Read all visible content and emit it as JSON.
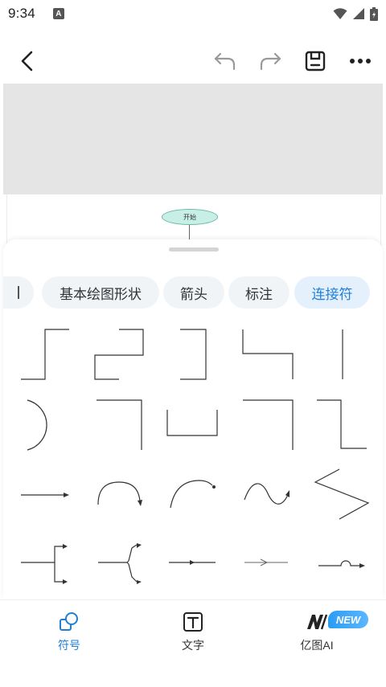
{
  "status_bar": {
    "time": "9:34",
    "notification_letter": "A"
  },
  "canvas": {
    "start_node_label": "开始"
  },
  "categories": [
    {
      "label": "",
      "active": false
    },
    {
      "label": "基本绘图形状",
      "active": false
    },
    {
      "label": "箭头",
      "active": false
    },
    {
      "label": "标注",
      "active": false
    },
    {
      "label": "连接符",
      "active": true
    }
  ],
  "connector_shapes": [
    "step-connector",
    "double-step-connector",
    "bracket-connector",
    "reverse-step-connector",
    "vertical-line",
    "arc-connector",
    "corner-connector",
    "u-connector",
    "corner-down-connector",
    "step-down-connector",
    "straight-arrow",
    "curved-arrow",
    "arc-arrow",
    "wave-arrow",
    "zigzag-line",
    "fork-connector",
    "y-connector",
    "line-with-midpoint",
    "thin-arrow",
    "jump-over-arrow"
  ],
  "bottom_nav": {
    "symbols_label": "符号",
    "text_label": "文字",
    "ai_label": "亿图AI",
    "new_badge": "NEW"
  },
  "colors": {
    "accent": "#1f7fd8",
    "start_node_fill": "#c8efe6"
  }
}
